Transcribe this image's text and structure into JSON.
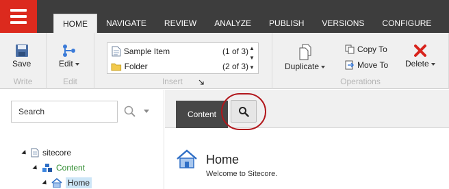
{
  "topbar": {
    "tabs": [
      {
        "label": "HOME",
        "active": true
      },
      {
        "label": "NAVIGATE",
        "active": false
      },
      {
        "label": "REVIEW",
        "active": false
      },
      {
        "label": "ANALYZE",
        "active": false
      },
      {
        "label": "PUBLISH",
        "active": false
      },
      {
        "label": "VERSIONS",
        "active": false
      },
      {
        "label": "CONFIGURE",
        "active": false
      }
    ]
  },
  "ribbon": {
    "write": {
      "save_label": "Save",
      "group_label": "Write"
    },
    "edit": {
      "edit_label": "Edit",
      "group_label": "Edit"
    },
    "insert": {
      "group_label": "Insert",
      "items": [
        {
          "name": "Sample Item",
          "count": "(1 of 3)",
          "icon": "document-icon"
        },
        {
          "name": "Folder",
          "count": "(2 of 3)",
          "icon": "folder-icon"
        }
      ]
    },
    "operations": {
      "group_label": "Operations",
      "duplicate_label": "Duplicate",
      "copy_to_label": "Copy To",
      "move_to_label": "Move To",
      "delete_label": "Delete"
    }
  },
  "left_panel": {
    "search_placeholder": "Search",
    "tree": [
      {
        "label": "sitecore",
        "icon": "document-icon"
      },
      {
        "label": "Content",
        "icon": "content-icon"
      },
      {
        "label": "Home",
        "icon": "home-icon",
        "selected": true
      }
    ]
  },
  "main": {
    "content_tab_label": "Content",
    "item": {
      "title": "Home",
      "description": "Welcome to Sitecore."
    }
  },
  "colors": {
    "topbar_bg": "#3d3d3d",
    "menu_red": "#dc2a1e",
    "ribbon_bg": "#f0f0f0",
    "highlight_ring": "#b1161b",
    "tree_green": "#2b8a2b",
    "selected_bg": "#cde6f7"
  }
}
